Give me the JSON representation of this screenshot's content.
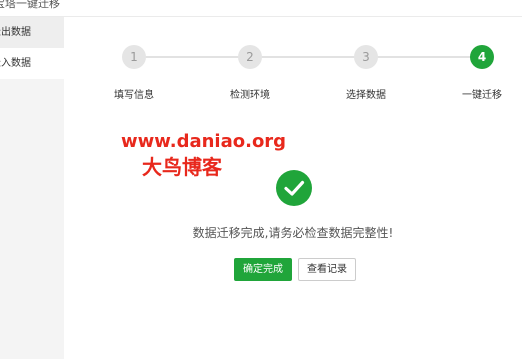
{
  "header": {
    "breadcrumb": "宝塔一键迁移"
  },
  "sidebar": {
    "items": [
      {
        "label": "迁出数据"
      },
      {
        "label": "迁入数据"
      }
    ]
  },
  "steps": [
    {
      "number": "1",
      "label": "填写信息",
      "state": "done"
    },
    {
      "number": "2",
      "label": "检测环境",
      "state": "done"
    },
    {
      "number": "3",
      "label": "选择数据",
      "state": "done"
    },
    {
      "number": "4",
      "label": "一键迁移",
      "state": "active"
    }
  ],
  "watermark": {
    "url": "www.daniao.org",
    "name": "大鸟博客",
    "color": "#e8281c"
  },
  "result": {
    "icon": "check-circle-icon",
    "message": "数据迁移完成,请务必检查数据完整性!"
  },
  "actions": {
    "confirm_label": "确定完成",
    "logs_label": "查看记录"
  },
  "colors": {
    "accent": "#20a53a",
    "inactive_step": "#e5e5e5"
  }
}
